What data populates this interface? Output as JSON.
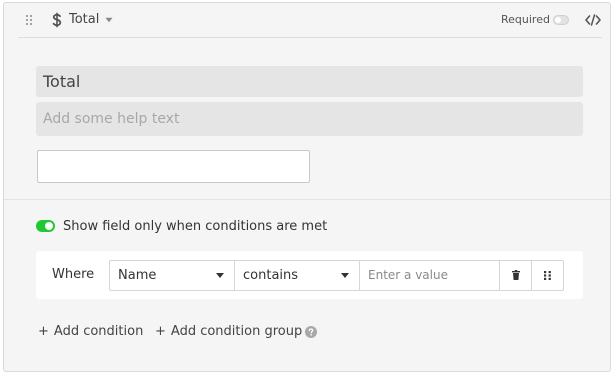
{
  "header": {
    "title": "Total",
    "field_type_icon": "currency-icon",
    "required_label": "Required",
    "required_on": false
  },
  "field": {
    "label_value": "Total",
    "help_placeholder": "Add some help text",
    "preview_value": ""
  },
  "conditions": {
    "toggle_on": true,
    "toggle_label": "Show field only when conditions are met",
    "where_label": "Where",
    "row": {
      "field": "Name",
      "operator": "contains",
      "value_placeholder": "Enter a value"
    },
    "add_condition_label": "Add condition",
    "add_group_label": "Add condition group"
  },
  "colors": {
    "toggle_on": "#20c933",
    "card_bg": "#f5f5f5",
    "input_bg": "#e5e5e5"
  }
}
